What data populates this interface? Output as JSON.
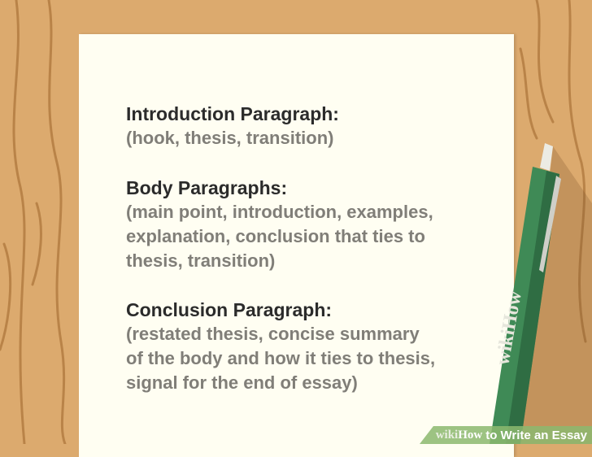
{
  "sections": [
    {
      "heading": "Introduction Paragraph:",
      "lines": [
        "(hook, thesis, transition)"
      ]
    },
    {
      "heading": "Body Paragraphs:",
      "lines": [
        "(main point, introduction, examples,",
        "explanation, conclusion that ties to",
        "thesis, transition)"
      ]
    },
    {
      "heading": "Conclusion Paragraph:",
      "lines": [
        "(restated thesis, concise summary",
        "of the body and how it ties to thesis,",
        "signal for the end of essay)"
      ]
    }
  ],
  "pen": {
    "logo": "wikiHow",
    "color": "#3f8a56"
  },
  "watermark": {
    "wiki": "wiki",
    "how": "How",
    "title": "to Write an Essay"
  },
  "colors": {
    "wood": "#dcaa6e",
    "paper": "#fffef2",
    "heading": "#2b2b2b",
    "body": "#807e78"
  }
}
